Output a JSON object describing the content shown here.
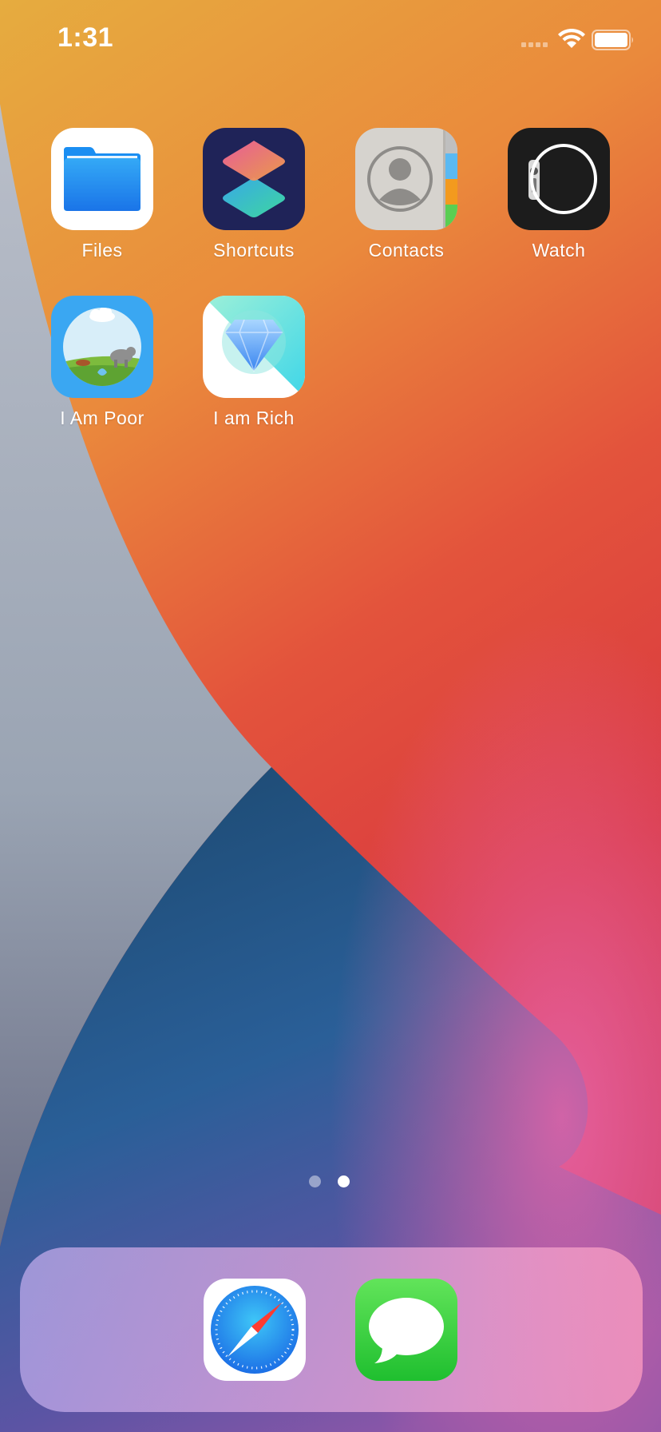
{
  "status_bar": {
    "time": "1:31"
  },
  "home_screen": {
    "apps": [
      {
        "label": "Files",
        "icon": "files-icon"
      },
      {
        "label": "Shortcuts",
        "icon": "shortcuts-icon"
      },
      {
        "label": "Contacts",
        "icon": "contacts-icon"
      },
      {
        "label": "Watch",
        "icon": "watch-icon"
      },
      {
        "label": "I Am Poor",
        "icon": "i-am-poor-icon"
      },
      {
        "label": "I am Rich",
        "icon": "i-am-rich-icon"
      }
    ],
    "page_indicator": {
      "pages": 2,
      "current": 2
    }
  },
  "dock": {
    "apps": [
      {
        "icon": "safari-icon"
      },
      {
        "icon": "messages-icon"
      }
    ]
  }
}
